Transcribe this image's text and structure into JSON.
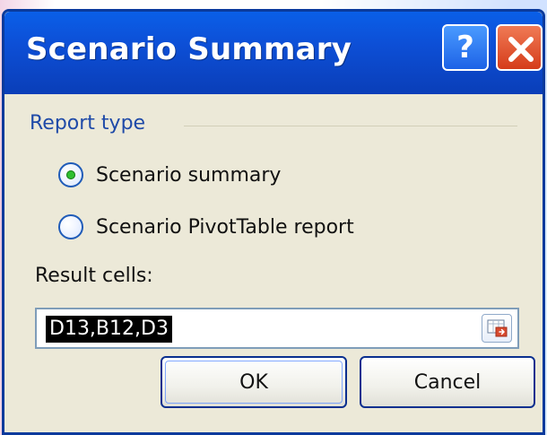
{
  "dialog": {
    "title": "Scenario Summary",
    "titlebar_buttons": {
      "help_glyph": "?",
      "close_glyph": "✕"
    }
  },
  "report_type": {
    "group_title": "Report type",
    "options": [
      {
        "label": "Scenario summary",
        "selected": true
      },
      {
        "label": "Scenario PivotTable report",
        "selected": false
      }
    ]
  },
  "result_cells": {
    "label": "Result cells:",
    "value": "D13,B12,D3"
  },
  "buttons": {
    "ok": "OK",
    "cancel": "Cancel"
  },
  "icons": {
    "help": "help-icon",
    "close": "close-icon",
    "reference_picker": "range-selector-icon"
  },
  "colors": {
    "titlebar": "#0a4fd6",
    "titlebar_help": "#1d62e6",
    "titlebar_close": "#d53c1a",
    "dialog_bg": "#ece9d8",
    "group_title": "#1f4aa8",
    "selection_bg": "#000000",
    "selection_text": "#ffffff"
  }
}
